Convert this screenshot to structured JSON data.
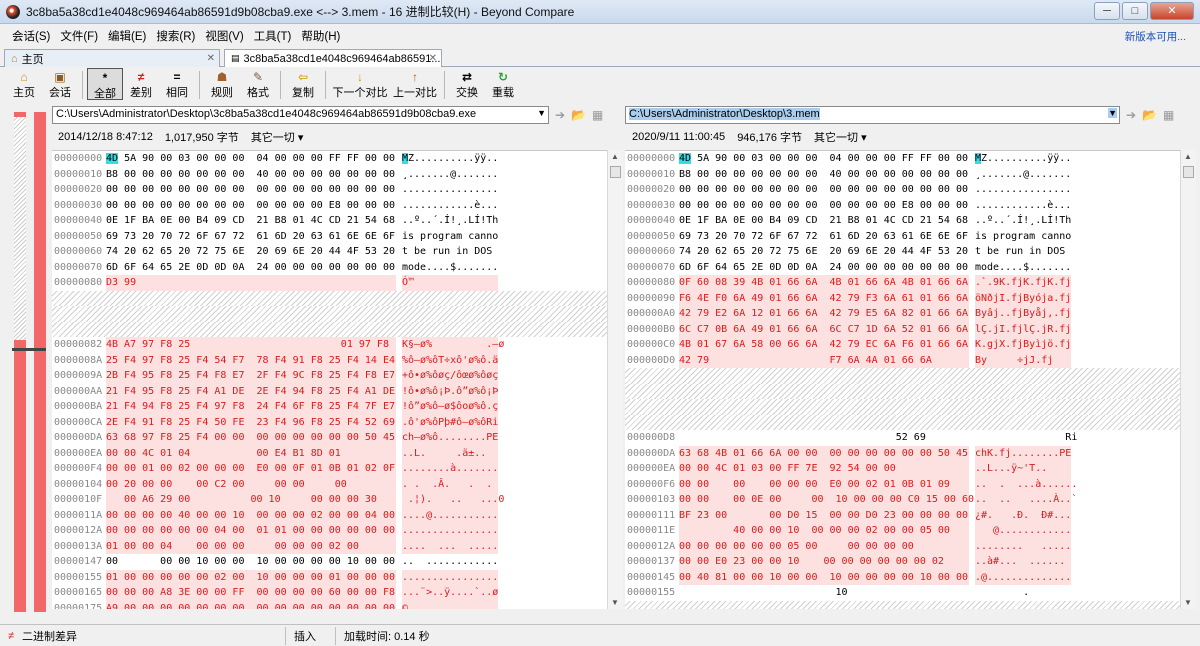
{
  "window": {
    "title": "3c8ba5a38cd1e4048c969464ab86591d9b08cba9.exe <--> 3.mem - 16 进制比较(H) - Beyond Compare",
    "min": "─",
    "max": "□",
    "close": "✕"
  },
  "menu": {
    "items": [
      "会话(S)",
      "文件(F)",
      "编辑(E)",
      "搜索(R)",
      "视图(V)",
      "工具(T)",
      "帮助(H)"
    ],
    "right": "新版本可用..."
  },
  "tabs": [
    {
      "label": "主页"
    },
    {
      "label": "3c8ba5a38cd1e4048c969464ab86591..."
    }
  ],
  "toolbar": [
    {
      "label": "主页",
      "icon": "⌂",
      "name": "home"
    },
    {
      "label": "会话",
      "icon": "▣",
      "name": "session"
    },
    {
      "label": "全部",
      "icon": "*",
      "name": "all"
    },
    {
      "label": "差别",
      "icon": "≠",
      "name": "diff"
    },
    {
      "label": "相同",
      "icon": "=",
      "name": "same"
    },
    {
      "label": "规则",
      "icon": "☗",
      "name": "rules"
    },
    {
      "label": "格式",
      "icon": "✎",
      "name": "format"
    },
    {
      "label": "复制",
      "icon": "⇦",
      "name": "copy"
    },
    {
      "label": "下一个对比",
      "icon": "↓",
      "name": "next-diff"
    },
    {
      "label": "上一对比",
      "icon": "↑",
      "name": "prev-diff"
    },
    {
      "label": "交换",
      "icon": "⇄",
      "name": "swap"
    },
    {
      "label": "重载",
      "icon": "↻",
      "name": "reload"
    }
  ],
  "left": {
    "path": "C:\\Users\\Administrator\\Desktop\\3c8ba5a38cd1e4048c969464ab86591d9b08cba9.exe",
    "date": "2014/12/18 8:47:12",
    "size": "1,017,950 字节",
    "other": "其它一切 ▾",
    "rows": [
      {
        "a": "00000000",
        "b": "4D 5A 90 00 03 00 00 00  04 00 00 00 FF FF 00 00",
        "t": "MZ..........ÿÿ..",
        "k": "c"
      },
      {
        "a": "00000010",
        "b": "B8 00 00 00 00 00 00 00  40 00 00 00 00 00 00 00",
        "t": "¸.......@.......",
        "k": "n"
      },
      {
        "a": "00000020",
        "b": "00 00 00 00 00 00 00 00  00 00 00 00 00 00 00 00",
        "t": "................",
        "k": "n"
      },
      {
        "a": "00000030",
        "b": "00 00 00 00 00 00 00 00  00 00 00 00 E8 00 00 00",
        "t": "............è...",
        "k": "n"
      },
      {
        "a": "00000040",
        "b": "0E 1F BA 0E 00 B4 09 CD  21 B8 01 4C CD 21 54 68",
        "t": "..º..´.Í!¸.LÍ!Th",
        "k": "n"
      },
      {
        "a": "00000050",
        "b": "69 73 20 70 72 6F 67 72  61 6D 20 63 61 6E 6E 6F",
        "t": "is program canno",
        "k": "n"
      },
      {
        "a": "00000060",
        "b": "74 20 62 65 20 72 75 6E  20 69 6E 20 44 4F 53 20",
        "t": "t be run in DOS ",
        "k": "n"
      },
      {
        "a": "00000070",
        "b": "6D 6F 64 65 2E 0D 0D 0A  24 00 00 00 00 00 00 00",
        "t": "mode....$.......",
        "k": "n"
      },
      {
        "a": "00000080",
        "b": "D3 99",
        "t": "Ó™",
        "k": "r"
      },
      {
        "a": "",
        "b": "",
        "t": "",
        "k": "g"
      },
      {
        "a": "",
        "b": "",
        "t": "",
        "k": "g"
      },
      {
        "a": "",
        "b": "",
        "t": "",
        "k": "g"
      },
      {
        "a": "00000082",
        "b": "4B A7 97 F8 25                         01 97 F8",
        "t": "K§—ø%         .—ø",
        "k": "r"
      },
      {
        "a": "0000008A",
        "b": "25 F4 97 F8 25 F4 54 F7  78 F4 91 F8 25 F4 14 E4",
        "t": "%ô—ø%ôT÷xô'ø%ô.ä",
        "k": "r"
      },
      {
        "a": "0000009A",
        "b": "2B F4 95 F8 25 F4 F8 E7  2F F4 9C F8 25 F4 F8 E7",
        "t": "+ô•ø%ôøç/ôœø%ôøç",
        "k": "r"
      },
      {
        "a": "000000AA",
        "b": "21 F4 95 F8 25 F4 A1 DE  2E F4 94 F8 25 F4 A1 DE",
        "t": "!ô•ø%ô¡Þ.ô”ø%ô¡Þ",
        "k": "r"
      },
      {
        "a": "000000BA",
        "b": "21 F4 94 F8 25 F4 97 F8  24 F4 6F F8 25 F4 7F E7",
        "t": "!ô”ø%ô—ø$ôoø%ô.ç",
        "k": "r"
      },
      {
        "a": "000000CA",
        "b": "2E F4 91 F8 25 F4 50 FE  23 F4 96 F8 25 F4 52 69",
        "t": ".ô'ø%ôPþ#ô–ø%ôRi",
        "k": "r"
      },
      {
        "a": "000000DA",
        "b": "63 68 97 F8 25 F4 00 00  00 00 00 00 00 00 50 45",
        "t": "ch—ø%ô........PE",
        "k": "r"
      },
      {
        "a": "000000EA",
        "b": "00 00 4C 01 04           00 E4 B1 8D 01",
        "t": "..L.     .ä±..",
        "k": "r"
      },
      {
        "a": "000000F4",
        "b": "00 00 01 00 02 00 00 00  E0 00 0F 01 0B 01 02 0F",
        "t": "........à.......",
        "k": "r"
      },
      {
        "a": "00000104",
        "b": "00 20 00 00    00 C2 00     00 00     00",
        "t": ". .  .Â.   .  .",
        "k": "r"
      },
      {
        "a": "0000010F",
        "b": "   00 A6 29 00          00 10     00 00 00 30",
        "t": " .¦).   ..   ...0",
        "k": "r"
      },
      {
        "a": "0000011A",
        "b": "00 00 00 00 40 00 00 10  00 00 00 02 00 00 04 00",
        "t": "....@...........",
        "k": "r"
      },
      {
        "a": "0000012A",
        "b": "00 00 00 00 00 00 04 00  01 01 00 00 00 00 00 00",
        "t": "................",
        "k": "r"
      },
      {
        "a": "0000013A",
        "b": "01 00 00 04    00 00 00     00 00 00 02 00",
        "t": "....  ...  .....",
        "k": "r"
      },
      {
        "a": "00000147",
        "b": "00       00 00 10 00 00  10 00 00 00 00 10 00 00",
        "t": "..  ............",
        "k": "n"
      },
      {
        "a": "00000155",
        "b": "01 00 00 00 00 00 02 00  10 00 00 00 01 00 00 00",
        "t": "................",
        "k": "r"
      },
      {
        "a": "00000165",
        "b": "00 00 00 A8 3E 00 00 FF  00 00 00 00 60 00 00 F8",
        "t": "...¨>..ÿ....`..ø",
        "k": "r"
      },
      {
        "a": "00000175",
        "b": "A9 00 00 00 00 00 00 00  00 00 00 00 00 00 00 00",
        "t": "©...............",
        "k": "r"
      }
    ]
  },
  "right": {
    "path": "C:\\Users\\Administrator\\Desktop\\3.mem",
    "date": "2020/9/11 11:00:45",
    "size": "946,176 字节",
    "other": "其它一切 ▾",
    "rows": [
      {
        "a": "00000000",
        "b": "4D 5A 90 00 03 00 00 00  04 00 00 00 FF FF 00 00",
        "t": "MZ..........ÿÿ..",
        "k": "c"
      },
      {
        "a": "00000010",
        "b": "B8 00 00 00 00 00 00 00  40 00 00 00 00 00 00 00",
        "t": "¸.......@.......",
        "k": "n"
      },
      {
        "a": "00000020",
        "b": "00 00 00 00 00 00 00 00  00 00 00 00 00 00 00 00",
        "t": "................",
        "k": "n"
      },
      {
        "a": "00000030",
        "b": "00 00 00 00 00 00 00 00  00 00 00 00 E8 00 00 00",
        "t": "............è...",
        "k": "n"
      },
      {
        "a": "00000040",
        "b": "0E 1F BA 0E 00 B4 09 CD  21 B8 01 4C CD 21 54 68",
        "t": "..º..´.Í!¸.LÍ!Th",
        "k": "n"
      },
      {
        "a": "00000050",
        "b": "69 73 20 70 72 6F 67 72  61 6D 20 63 61 6E 6E 6F",
        "t": "is program canno",
        "k": "n"
      },
      {
        "a": "00000060",
        "b": "74 20 62 65 20 72 75 6E  20 69 6E 20 44 4F 53 20",
        "t": "t be run in DOS ",
        "k": "n"
      },
      {
        "a": "00000070",
        "b": "6D 6F 64 65 2E 0D 0D 0A  24 00 00 00 00 00 00 00",
        "t": "mode....$.......",
        "k": "n"
      },
      {
        "a": "00000080",
        "b": "0F 60 08 39 4B 01 66 6A  4B 01 66 6A 4B 01 66 6A",
        "t": ".`.9K.fjK.fjK.fj",
        "k": "r"
      },
      {
        "a": "00000090",
        "b": "F6 4E F0 6A 49 01 66 6A  42 79 F3 6A 61 01 66 6A",
        "t": "öNðjI.fjByójа.fj",
        "k": "r"
      },
      {
        "a": "000000A0",
        "b": "42 79 E2 6A 12 01 66 6A  42 79 E5 6A 82 01 66 6A",
        "t": "Byâj..fjByåj‚.fj",
        "k": "r"
      },
      {
        "a": "000000B0",
        "b": "6C C7 0B 6A 49 01 66 6A  6C C7 1D 6A 52 01 66 6A",
        "t": "lÇ.jI.fjlÇ.jR.fj",
        "k": "r"
      },
      {
        "a": "000000C0",
        "b": "4B 01 67 6A 58 00 66 6A  42 79 EC 6A F6 01 66 6A",
        "t": "K.gjX.fjByìjö.fj",
        "k": "r"
      },
      {
        "a": "000000D0",
        "b": "42 79                    F7 6A 4A 01 66 6A",
        "t": "By     ÷jJ.fj",
        "k": "r"
      },
      {
        "a": "",
        "b": "",
        "t": "",
        "k": "g"
      },
      {
        "a": "",
        "b": "",
        "t": "",
        "k": "g"
      },
      {
        "a": "",
        "b": "",
        "t": "",
        "k": "g"
      },
      {
        "a": "",
        "b": "",
        "t": "",
        "k": "g"
      },
      {
        "a": "000000D8",
        "b": "                                    52 69",
        "t": "               Ri",
        "k": "n"
      },
      {
        "a": "000000DA",
        "b": "63 68 4B 01 66 6A 00 00  00 00 00 00 00 00 50 45",
        "t": "chK.fj........PE",
        "k": "r"
      },
      {
        "a": "000000EA",
        "b": "00 00 4C 01 03 00 FF 7E  92 54 00 00",
        "t": "..L...ÿ~'T..",
        "k": "r"
      },
      {
        "a": "000000F6",
        "b": "00 00    00    00 00 00  E0 00 02 01 0B 01 09",
        "t": "..  .  ...à......",
        "k": "r"
      },
      {
        "a": "00000103",
        "b": "00 00    00 0E 00     00  10 00 00 00 C0 15 00 60",
        "t": "..  ..   ....À..`",
        "k": "r"
      },
      {
        "a": "00000111",
        "b": "BF 23 00       00 D0 15  00 00 D0 23 00 00 00 00",
        "t": "¿#.   .Ð.  Ð#...",
        "k": "r"
      },
      {
        "a": "0000011E",
        "b": "         40 00 00 10  00 00 00 02 00 00 05 00",
        "t": "   @............",
        "k": "r"
      },
      {
        "a": "0000012A",
        "b": "00 00 00 00 00 00 05 00     00 00 00 00",
        "t": "........   .....",
        "k": "r"
      },
      {
        "a": "00000137",
        "b": "00 00 E0 23 00 00 10    00 00 00 00 00 00 02",
        "t": "..à#...  ......",
        "k": "r"
      },
      {
        "a": "00000145",
        "b": "00 40 81 00 00 10 00 00  10 00 00 00 00 10 00 00",
        "t": ".@..............",
        "k": "r"
      },
      {
        "a": "00000155",
        "b": "                          10",
        "t": "        .",
        "k": "n"
      },
      {
        "a": "",
        "b": "",
        "t": "",
        "k": "g"
      },
      {
        "a": "",
        "b": "",
        "t": "",
        "k": "g"
      },
      {
        "a": "",
        "b": "",
        "t": "",
        "k": "g"
      }
    ]
  },
  "status": {
    "icon": "≠",
    "diff_label": "二进制差异",
    "mode": "插入",
    "load_time": "加载时间: 0.14 秒"
  },
  "colors": {
    "diff": "#d91c1c",
    "highlight": "#33dde6",
    "pink": "#fde0e0",
    "overview": "#f26767"
  }
}
